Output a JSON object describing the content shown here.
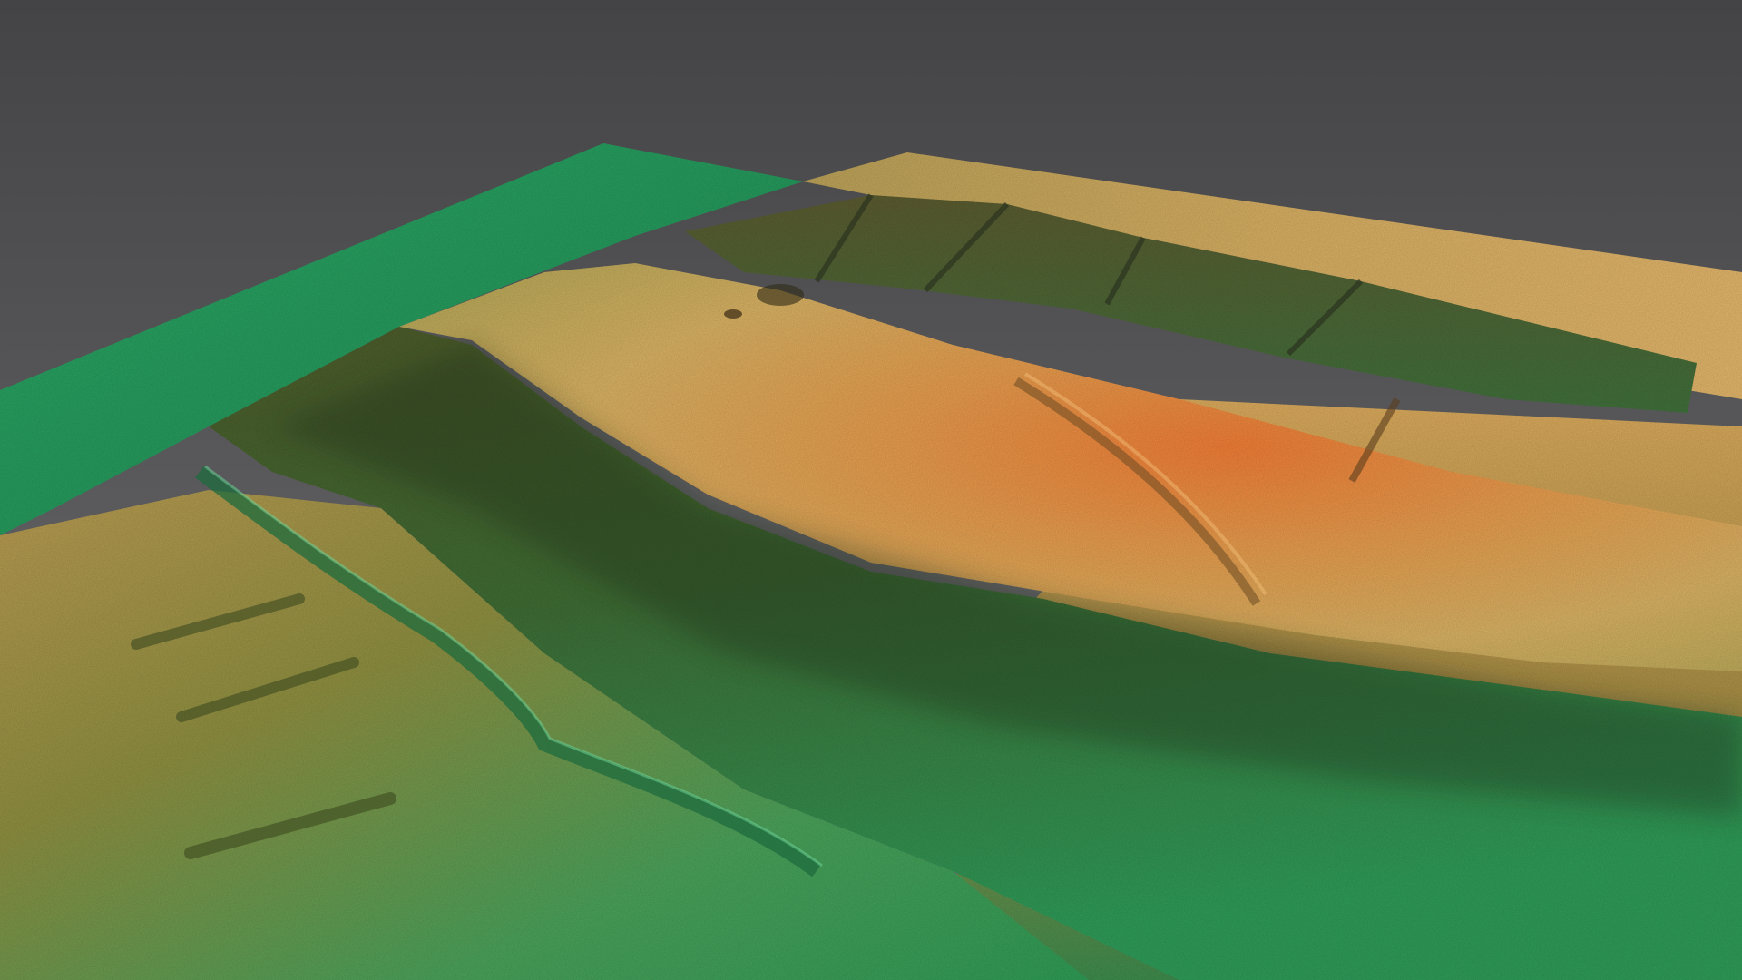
{
  "scene": {
    "kind": "3d-shaded-terrain-relief",
    "colors": {
      "background_top": "#48484a",
      "background_bottom": "#707072",
      "low_elevation": "#1f9a5a",
      "mid_elevation": "#8a8a3a",
      "high_elevation": "#d8a85a",
      "peak_elevation": "#e8793a",
      "shadow": "#2f3a22"
    }
  }
}
